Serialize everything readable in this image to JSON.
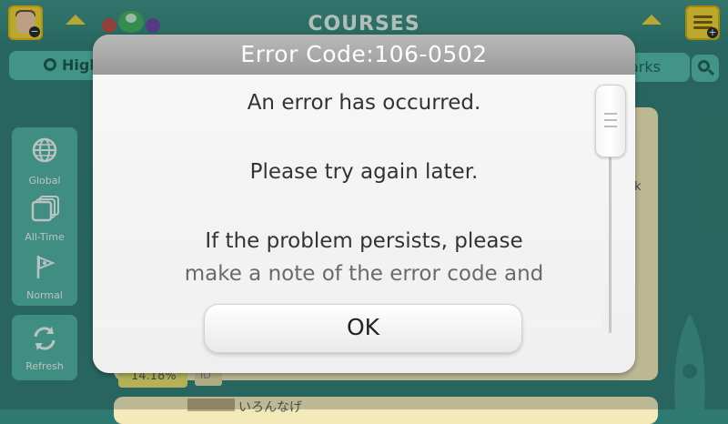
{
  "topbar": {
    "title": "COURSES",
    "left_tab_label": "High",
    "right_tab_label": "arks"
  },
  "sidebar": {
    "filters": [
      {
        "label": "Global",
        "icon": "globe-icon"
      },
      {
        "label": "All-Time",
        "icon": "stacked-windows-icon"
      },
      {
        "label": "Normal",
        "icon": "flag-icon"
      }
    ],
    "refresh_label": "Refresh"
  },
  "course_list": {
    "partial_label": "ck",
    "percent": "14.18%",
    "id_label": "ID",
    "next_course_title": "いろんなげ"
  },
  "dialog": {
    "title": "Error Code:106-0502",
    "lines": [
      "An error has occurred.",
      "Please try again later.",
      "If the problem persists, please",
      "make a note of the error code and"
    ],
    "ok_label": "OK"
  },
  "colors": {
    "background": "#2f7a70",
    "accent_yellow": "#f2d22c",
    "panel_teal": "#4fb0a0",
    "dialog_header": "#a8a8a8"
  }
}
